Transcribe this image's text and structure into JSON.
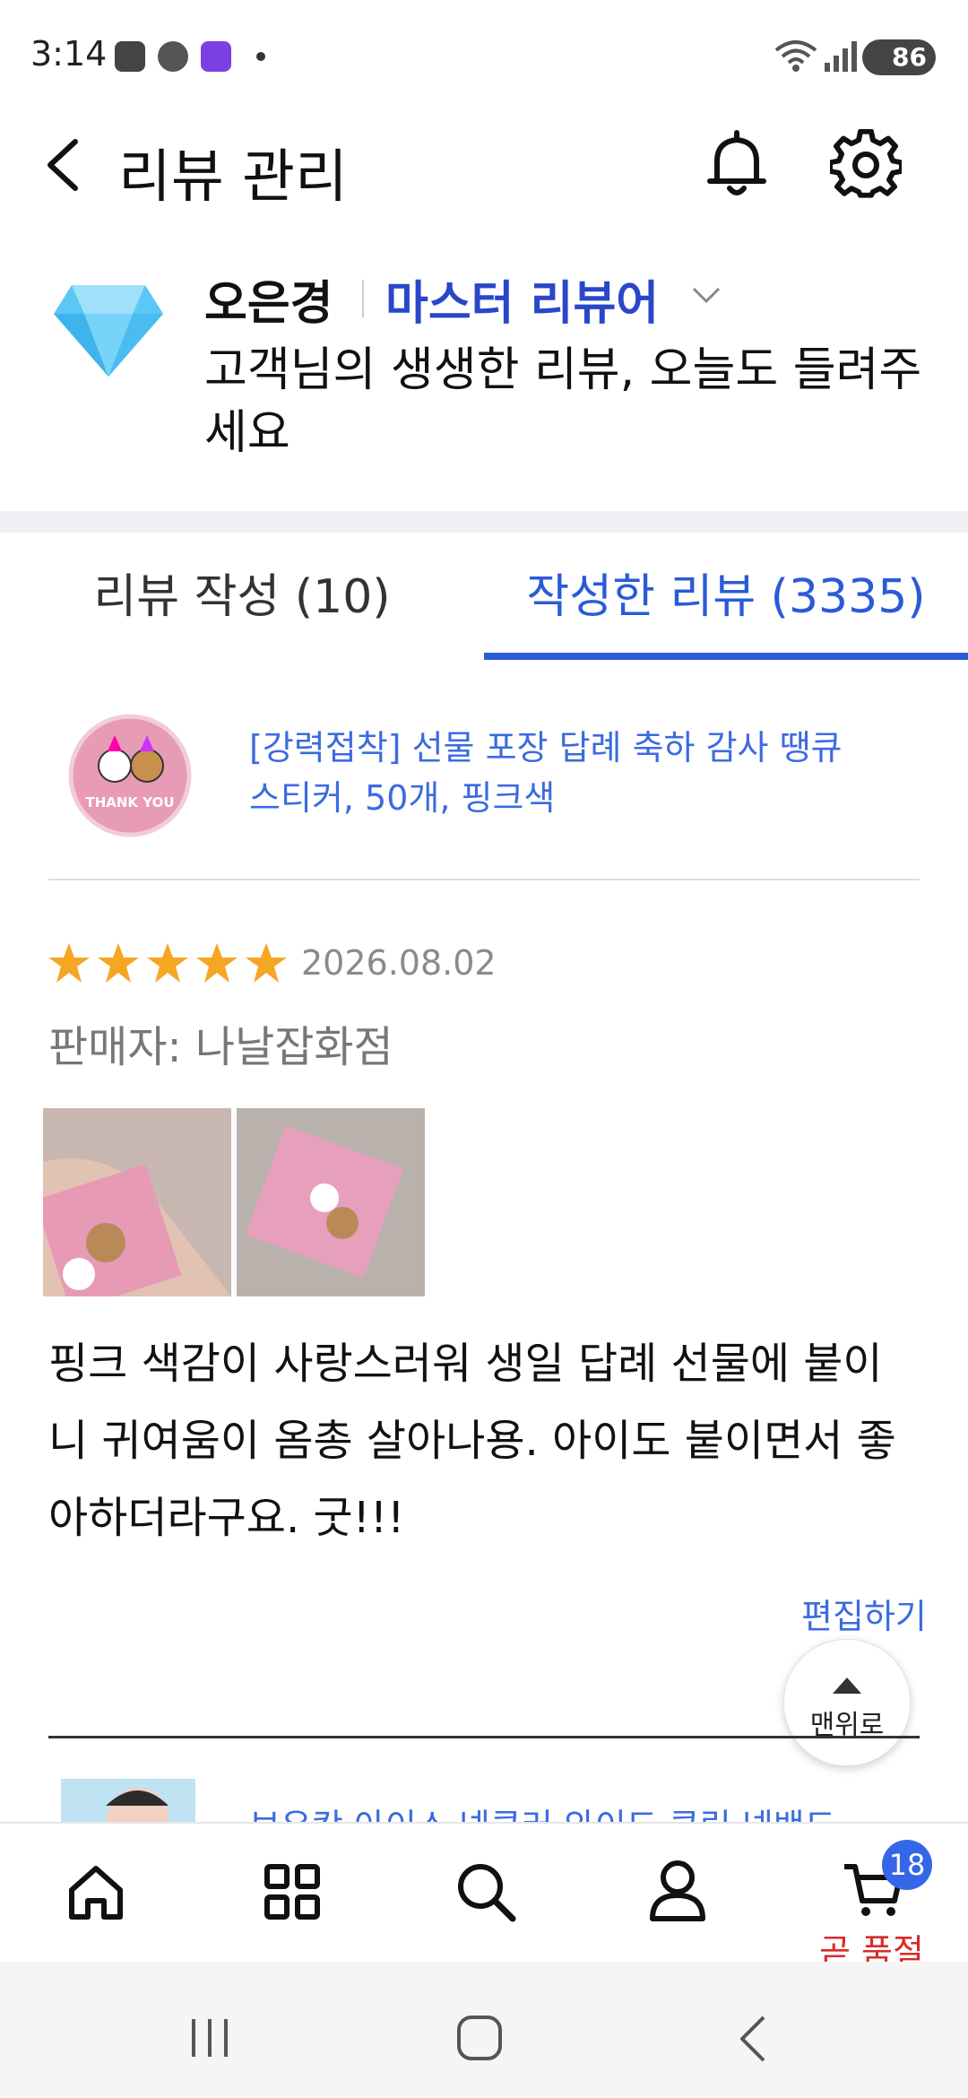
{
  "status_bar": {
    "time": "3:14",
    "battery": "86",
    "wifi_label": "6"
  },
  "header": {
    "title": "리뷰 관리"
  },
  "profile": {
    "name": "오은경",
    "grade": "마스터 리뷰어",
    "subtitle": "고객님의 생생한 리뷰, 오늘도 들려주세요"
  },
  "tabs": [
    {
      "label": "리뷰 작성 (10)"
    },
    {
      "label": "작성한 리뷰 (3335)"
    }
  ],
  "review": {
    "product_name": "[강력접착] 선물 포장 답례 축하 감사 땡큐 스티커, 50개, 핑크색",
    "product_image_text": "THANK YOU",
    "rating": 5,
    "date": "2026.08.02",
    "seller": "판매자: 나날잡화점",
    "text": "핑크 색감이 사랑스러워 생일 답례 선물에 붙이니 귀여움이 옴총 살아나용. 아이도 붙이면서 좋아하더라구요. 굿!!!",
    "edit_label": "편집하기"
  },
  "scroll_top": {
    "label": "맨위로"
  },
  "next_review": {
    "product_name_partial": "보우캉 아이스 넥쿨러 와이드 쿨링 넥밴드"
  },
  "bottom_nav": {
    "cart_badge": "18",
    "cart_status": "곧 품절"
  },
  "colors": {
    "accent": "#2a5bd7",
    "grade": "#2a46c9",
    "link": "#3b6be0",
    "star": "#f5a623",
    "soldout": "#d92a2a"
  }
}
